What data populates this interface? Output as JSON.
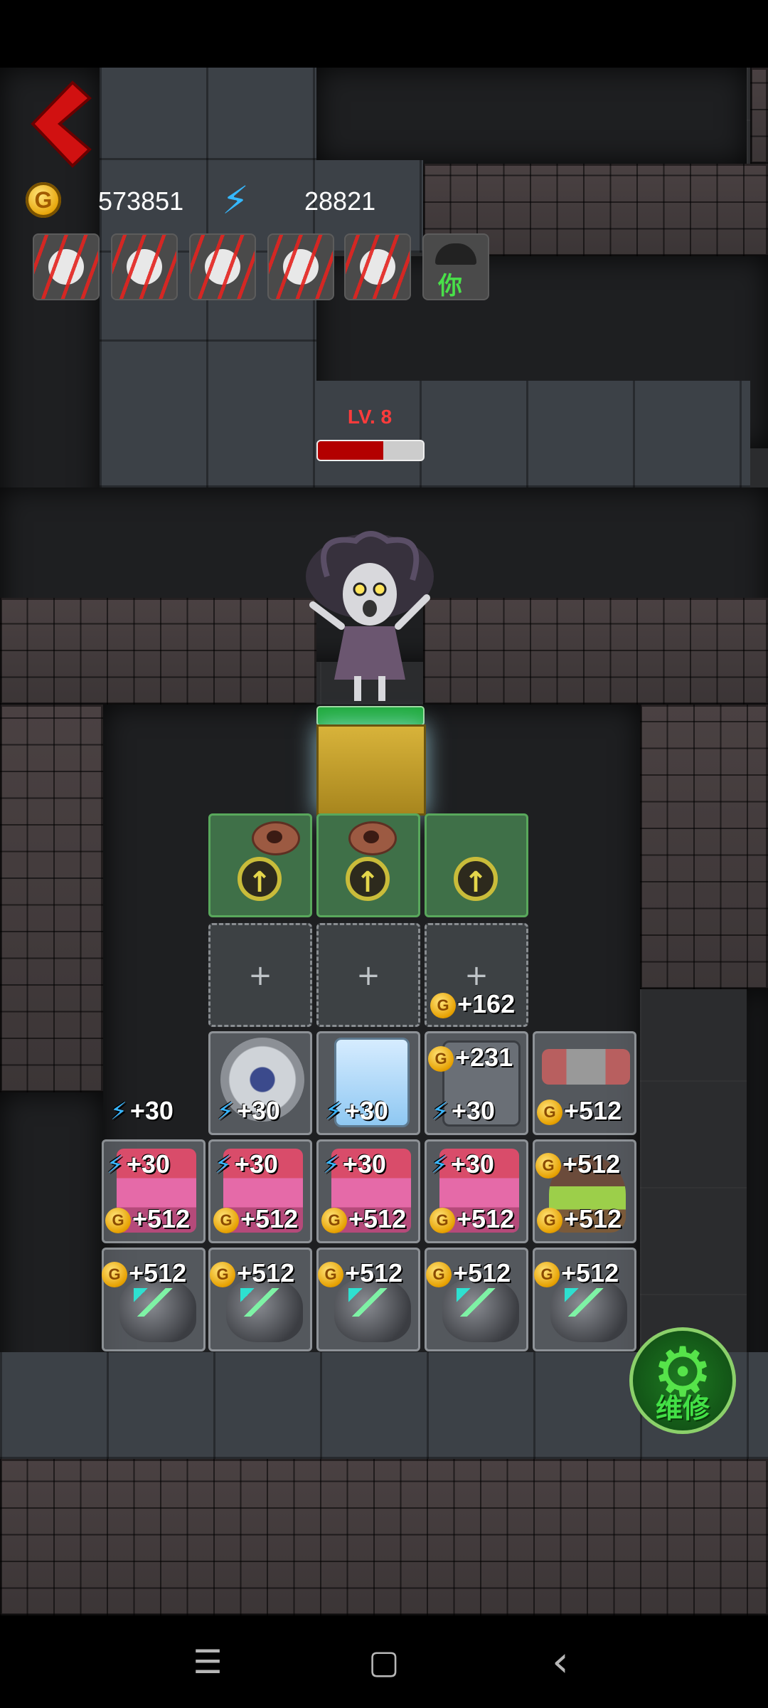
{
  "hud": {
    "coin_label": "G",
    "coins": "573851",
    "energy": "28821",
    "back_icon": "chevron-left-icon"
  },
  "players": [
    {
      "type": "clawed"
    },
    {
      "type": "clawed"
    },
    {
      "type": "clawed"
    },
    {
      "type": "clawed"
    },
    {
      "type": "clawed"
    },
    {
      "type": "you",
      "label": "你"
    }
  ],
  "enemy": {
    "level_label": "LV. 8",
    "hp_fraction": 0.62
  },
  "grid": {
    "upgrade_symbol": "↑",
    "plus_symbol": "+",
    "bonuses": {
      "e_30": "+30",
      "g_512": "+512",
      "g_162": "+162",
      "g_231": "+231"
    }
  },
  "colors": {
    "accent_red": "#e3231f",
    "energy_blue": "#39b6ff",
    "repair_green": "#43e046",
    "hp_red": "#b30000"
  },
  "repair": {
    "label": "维修",
    "icon": "wrench-gear-icon"
  },
  "nav": {
    "menu_icon": "☰",
    "home_icon": "▢",
    "back_icon": "‹"
  }
}
